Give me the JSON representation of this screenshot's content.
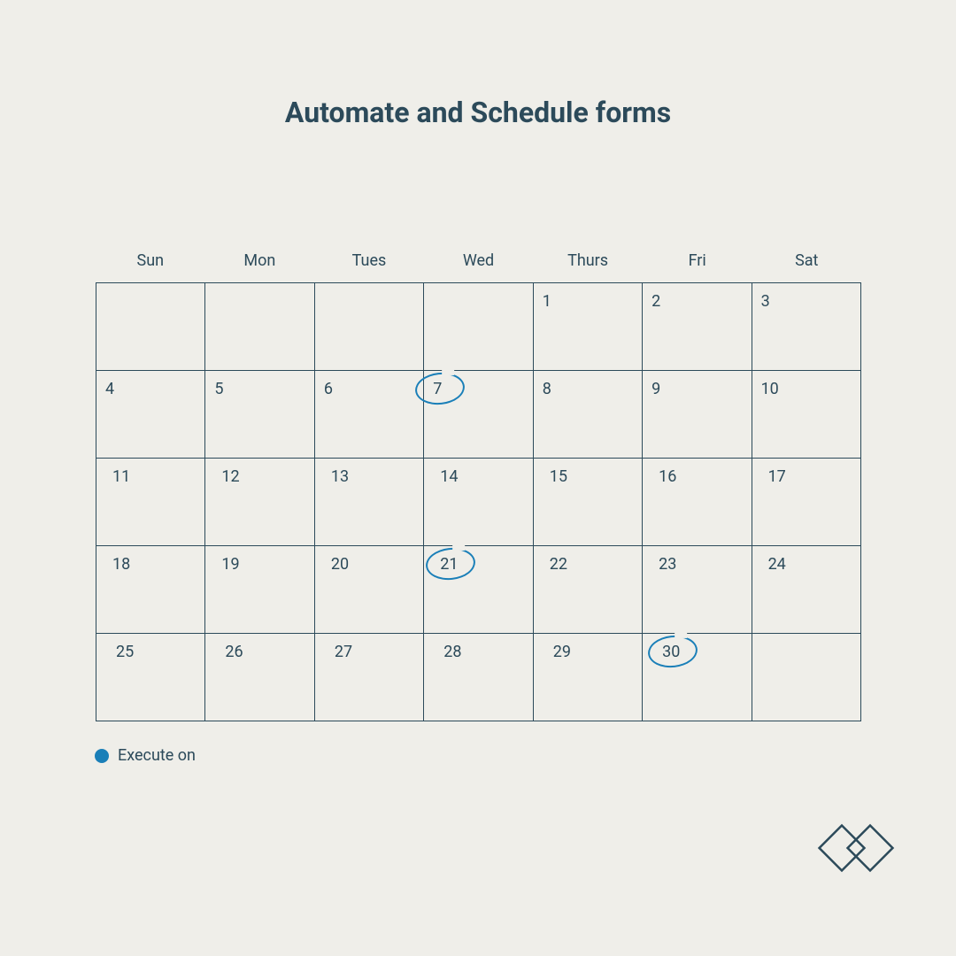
{
  "title": "Automate and Schedule forms",
  "weekdays": [
    "Sun",
    "Mon",
    "Tues",
    "Wed",
    "Thurs",
    "Fri",
    "Sat"
  ],
  "legend": {
    "execute_label": "Execute on"
  },
  "colors": {
    "accent": "#1a7fb8",
    "text": "#2c4a5a",
    "bg": "#efeee9"
  },
  "calendar": {
    "cells": [
      {
        "day": ""
      },
      {
        "day": ""
      },
      {
        "day": ""
      },
      {
        "day": ""
      },
      {
        "day": "1"
      },
      {
        "day": "2"
      },
      {
        "day": "3"
      },
      {
        "day": "4"
      },
      {
        "day": "5"
      },
      {
        "day": "6"
      },
      {
        "day": "7",
        "circled": true
      },
      {
        "day": "8"
      },
      {
        "day": "9"
      },
      {
        "day": "10"
      },
      {
        "day": "11"
      },
      {
        "day": "12"
      },
      {
        "day": "13"
      },
      {
        "day": "14"
      },
      {
        "day": "15"
      },
      {
        "day": "16"
      },
      {
        "day": "17"
      },
      {
        "day": "18"
      },
      {
        "day": "19"
      },
      {
        "day": "20"
      },
      {
        "day": "21",
        "circled": true
      },
      {
        "day": "22"
      },
      {
        "day": "23"
      },
      {
        "day": "24"
      },
      {
        "day": "25"
      },
      {
        "day": "26"
      },
      {
        "day": "27"
      },
      {
        "day": "28"
      },
      {
        "day": "29"
      },
      {
        "day": "30",
        "circled": true
      },
      {
        "day": ""
      }
    ]
  }
}
